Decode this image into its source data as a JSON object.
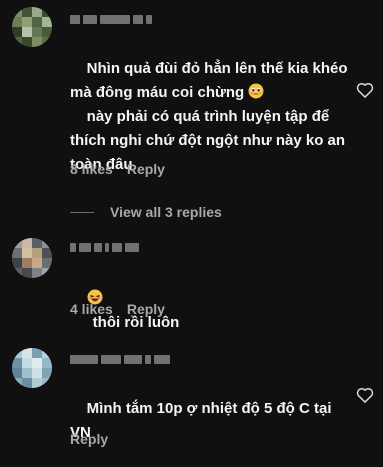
{
  "comments": [
    {
      "text": "Nhìn quả đùi đỏ hẳn lên thế kia khéo mà đông máu coi chừng \n này phải có quá trình luyện tập để thích nghi chứ đột ngột như này ko an toàn đâu",
      "likes": "8 likes",
      "reply": "Reply",
      "emoji": "pleading-face-emoji"
    },
    {
      "text": "thôi rồi luôn",
      "likes": "4 likes",
      "reply": "Reply",
      "emoji": "laughing-face-emoji"
    },
    {
      "text": "Mình tắm 10p ợ nhiệt độ 5 độ C tại VN",
      "likes": "",
      "reply": "Reply"
    }
  ],
  "view_replies": "View all 3 replies",
  "colors": {
    "background": "#101010",
    "text": "#f5f5f5",
    "muted": "#a8a8a8"
  },
  "icons": {
    "like": "heart-outline-icon"
  }
}
